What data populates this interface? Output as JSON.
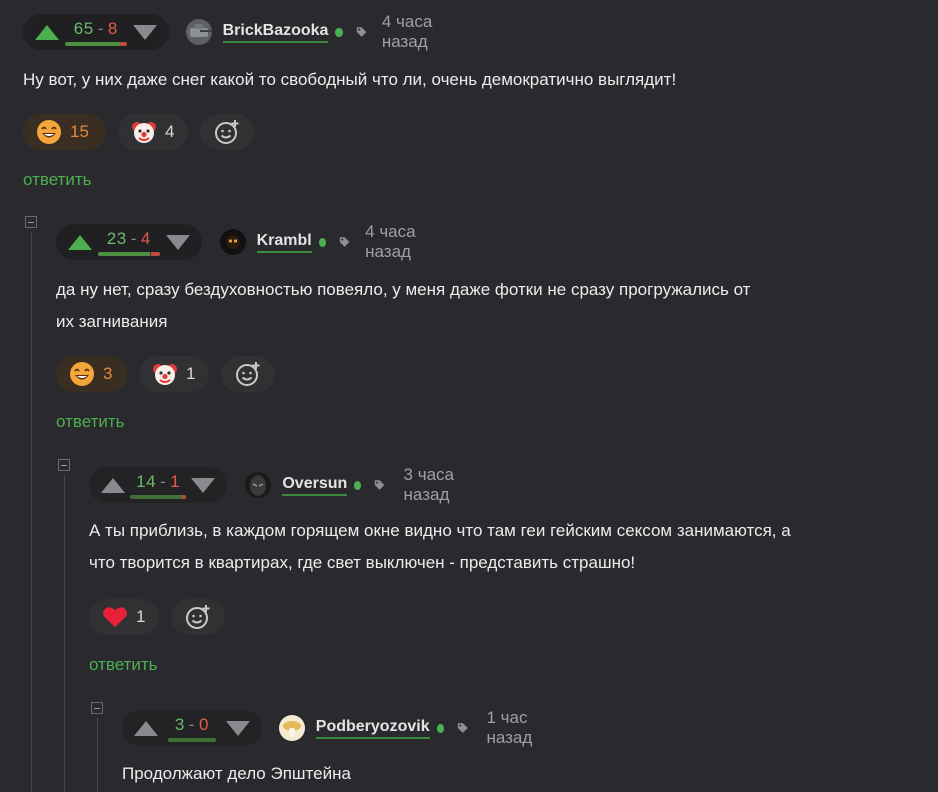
{
  "comments": [
    {
      "plus": "65",
      "minus": "8",
      "plus_ratio": 0.89,
      "author": "BrickBazooka",
      "time": "4 часа назад",
      "voted_up": true,
      "lines": [
        "Ну вот, у них даже снег какой то свободный что ли, очень демократично выглядит!"
      ],
      "reactions": [
        {
          "type": "laugh",
          "count": "15",
          "selected": true
        },
        {
          "type": "clown",
          "count": "4",
          "selected": false
        }
      ],
      "reply": "ответить"
    },
    {
      "plus": "23",
      "minus": "4",
      "plus_ratio": 0.85,
      "author": "Krambl",
      "time": "4 часа назад",
      "voted_up": true,
      "lines": [
        "да ну нет, сразу бездуховностью повеяло, у меня даже фотки не сразу прогружались от",
        "их загнивания"
      ],
      "reactions": [
        {
          "type": "laugh",
          "count": "3",
          "selected": true
        },
        {
          "type": "clown",
          "count": "1",
          "selected": false
        }
      ],
      "reply": "ответить"
    },
    {
      "plus": "14",
      "minus": "1",
      "plus_ratio": 0.93,
      "author": "Oversun",
      "time": "3 часа назад",
      "voted_up": false,
      "lines": [
        "А ты приблизь, в каждом горящем окне видно что там геи гейским сексом занимаются, а",
        "что творится в квартирах, где свет выключен - представить страшно!"
      ],
      "reactions": [
        {
          "type": "heart",
          "count": "1",
          "selected": false
        }
      ],
      "reply": "ответить"
    },
    {
      "plus": "3",
      "minus": "0",
      "plus_ratio": 1.0,
      "author": "Podberyozovik",
      "time": "1 час назад",
      "voted_up": false,
      "lines": [
        "Продолжают дело Эпштейна"
      ],
      "reactions": [],
      "reply": ""
    }
  ],
  "colors": {
    "accent": "#4caf50",
    "minus": "#e45a4a",
    "background": "#2a2a2e"
  }
}
